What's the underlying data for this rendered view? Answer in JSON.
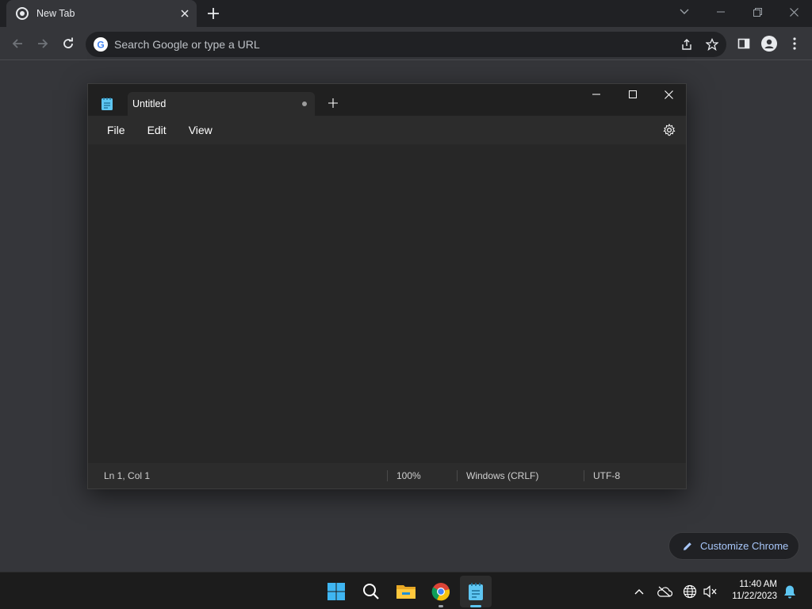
{
  "browser": {
    "tab_title": "New Tab",
    "omnibox_placeholder": "Search Google or type a URL",
    "customize_label": "Customize Chrome",
    "accent": "#a8c7fa"
  },
  "notepad": {
    "tab_title": "Untitled",
    "menu": [
      "File",
      "Edit",
      "View"
    ],
    "editor_text": "",
    "status": {
      "position": "Ln 1, Col 1",
      "zoom": "100%",
      "line_ending": "Windows (CRLF)",
      "encoding": "UTF-8"
    }
  },
  "taskbar": {
    "time": "11:40 AM",
    "date": "11/22/2023"
  }
}
